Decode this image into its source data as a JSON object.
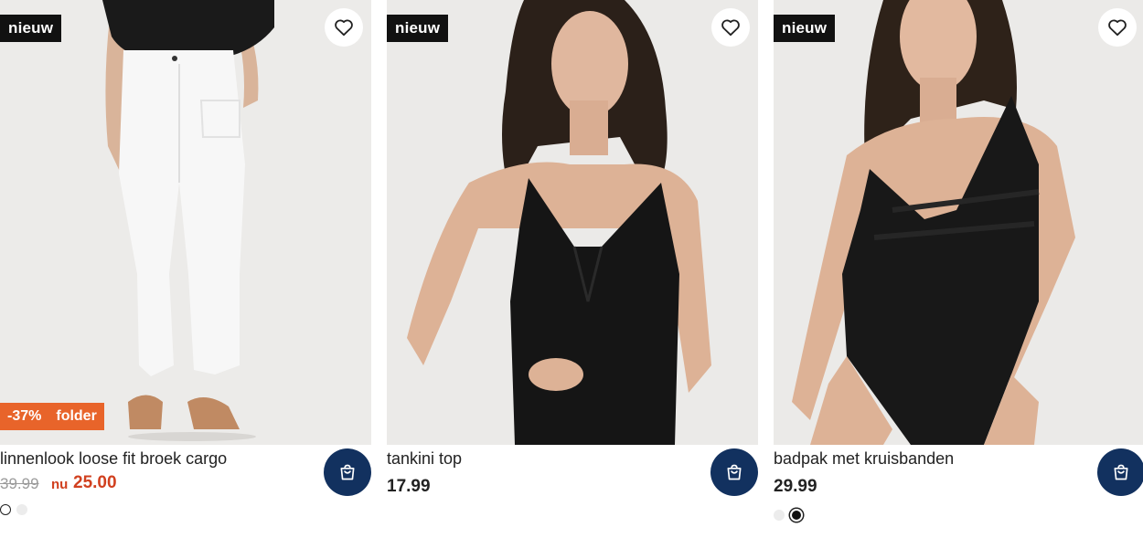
{
  "products": [
    {
      "badge": "nieuw",
      "title": "linnenlook loose fit broek cargo",
      "price_old": "39.99",
      "price_now_label": "nu",
      "price_now": "25.00",
      "promo": {
        "discount": "-37%",
        "label": "folder"
      },
      "favorite_icon": "heart-icon",
      "cart_icon": "shopping-bag-icon",
      "swatches": [
        "white",
        "light-grey"
      ],
      "selected_swatch": "white"
    },
    {
      "badge": "nieuw",
      "title": "tankini top",
      "price": "17.99",
      "favorite_icon": "heart-icon",
      "cart_icon": "shopping-bag-icon"
    },
    {
      "badge": "nieuw",
      "title": "badpak met kruisbanden",
      "price": "29.99",
      "favorite_icon": "heart-icon",
      "cart_icon": "shopping-bag-icon",
      "swatches": [
        "light-grey",
        "black"
      ],
      "selected_swatch": "black"
    }
  ],
  "colors": {
    "badge_bg": "#111111",
    "promo_bg": "#e8642a",
    "sale_price": "#d1401f",
    "cart_button": "#12315f",
    "photo_bg": "#ecebe9"
  }
}
